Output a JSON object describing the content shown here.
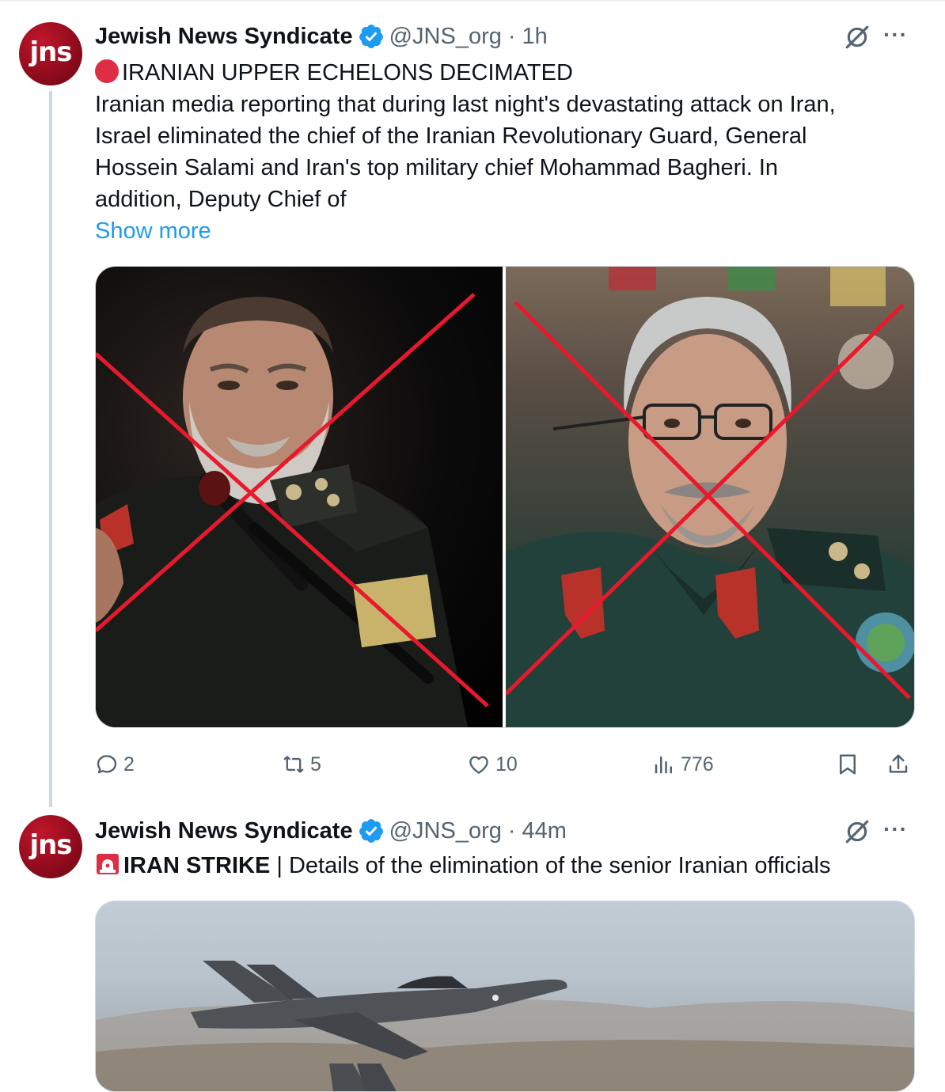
{
  "tweets": [
    {
      "author": {
        "name": "Jewish News Syndicate",
        "handle": "@JNS_org",
        "avatar_text": "jns"
      },
      "separator": "·",
      "time": "1h",
      "headline": "IRANIAN UPPER ECHELONS DECIMATED",
      "body_lines": [
        "Iranian media reporting that during last night's devastating attack on Iran,",
        "Israel eliminated the chief of the Iranian Revolutionary Guard, General",
        "Hossein Salami and Iran's top military chief Mohammad Bagheri. In",
        "addition, Deputy Chief of"
      ],
      "show_more": "Show more",
      "stats": {
        "replies": "2",
        "reposts": "5",
        "likes": "10",
        "views": "776"
      }
    },
    {
      "author": {
        "name": "Jewish News Syndicate",
        "handle": "@JNS_org",
        "avatar_text": "jns"
      },
      "separator": "·",
      "time": "44m",
      "headline_bold": "IRAN STRIKE",
      "headline_rest": " | Details of the elimination of the senior Iranian officials"
    }
  ],
  "icons": {
    "verified": "verified-badge-icon",
    "grok": "grok-icon",
    "more": "more-icon",
    "reply": "reply-icon",
    "repost": "repost-icon",
    "like": "like-icon",
    "views": "views-icon",
    "bookmark": "bookmark-icon",
    "share": "share-icon",
    "siren": "siren-icon"
  },
  "colors": {
    "accent": "#1d9bf0",
    "text": "#0f1419",
    "muted": "#536471",
    "avatar": "#a50f22",
    "red_mark": "#e8192c"
  },
  "more_glyph": "···"
}
